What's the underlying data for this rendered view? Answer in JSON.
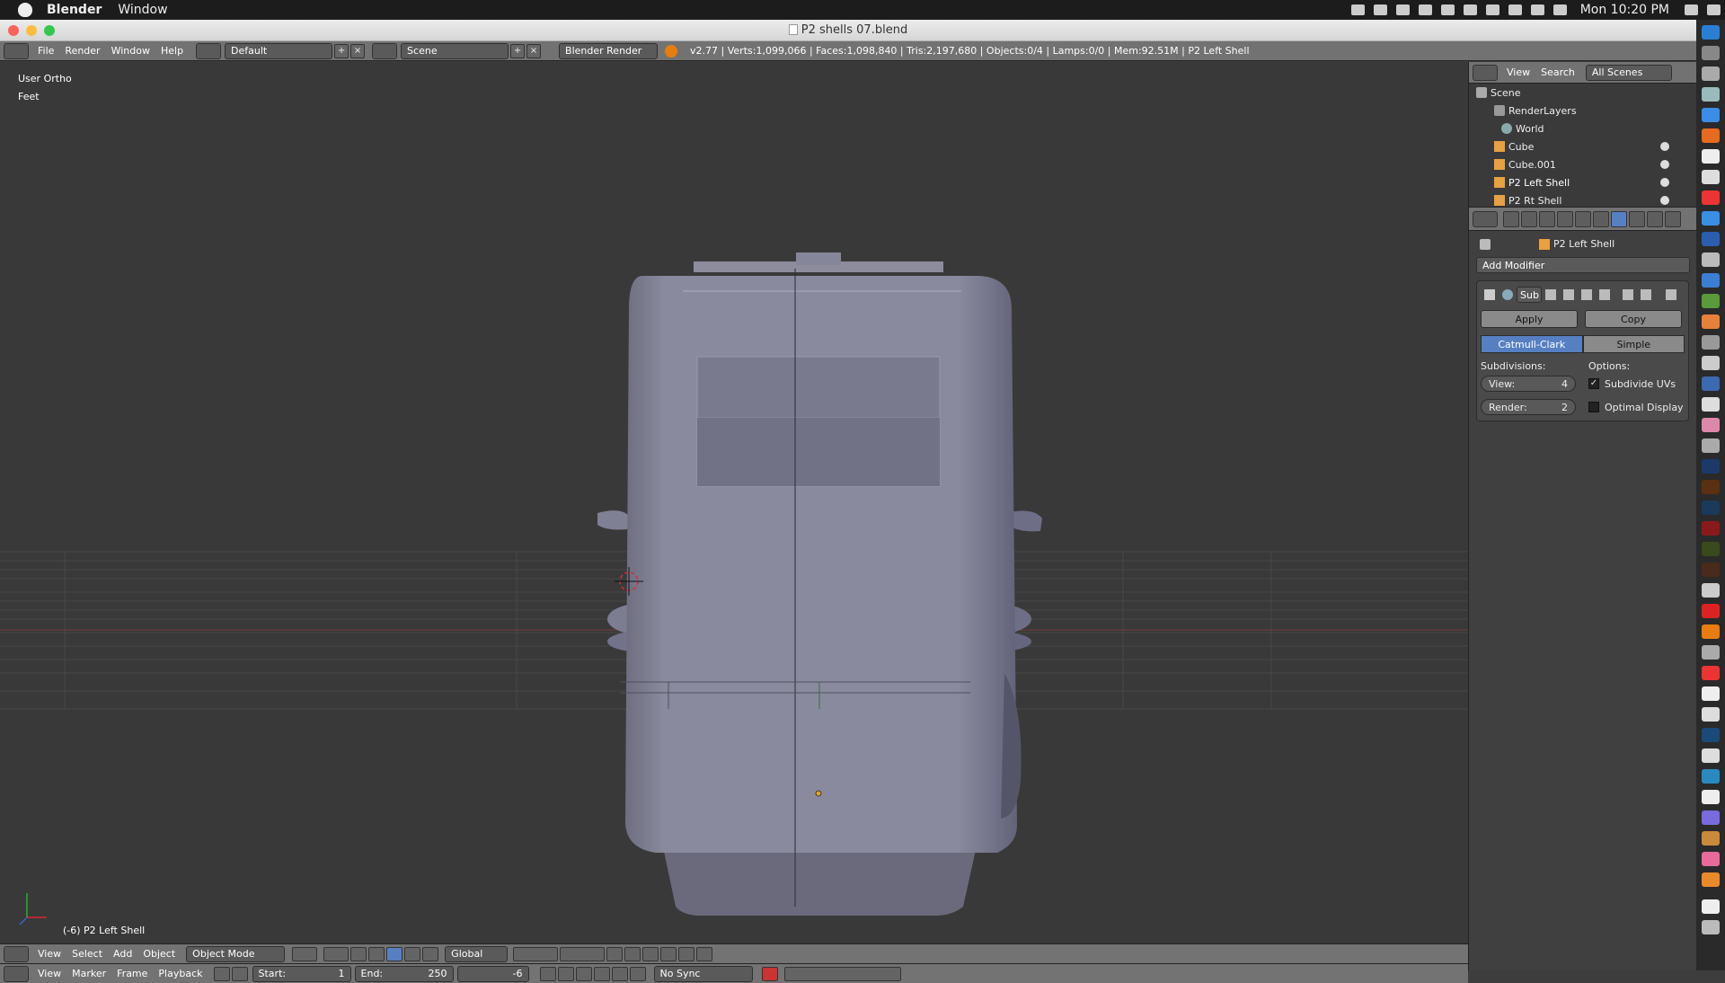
{
  "menubar": {
    "app": "Blender",
    "window": "Window",
    "clock": "Mon 10:20 PM"
  },
  "window": {
    "title": "P2 shells 07.blend"
  },
  "info": {
    "menus": [
      "File",
      "Render",
      "Window",
      "Help"
    ],
    "layout": "Default",
    "scene": "Scene",
    "engine": "Blender Render",
    "stats": "v2.77 | Verts:1,099,066 | Faces:1,098,840 | Tris:2,197,680 | Objects:0/4 | Lamps:0/0 | Mem:92.51M | P2 Left Shell"
  },
  "viewport": {
    "view": "User Ortho",
    "units": "Feet",
    "object": "(-6) P2 Left Shell"
  },
  "vp_header": {
    "menus": [
      "View",
      "Select",
      "Add",
      "Object"
    ],
    "mode": "Object Mode",
    "orientation": "Global"
  },
  "timeline": {
    "menus": [
      "View",
      "Marker",
      "Frame",
      "Playback"
    ],
    "start_label": "Start:",
    "start": "1",
    "end_label": "End:",
    "end": "250",
    "current": "-6",
    "sync": "No Sync"
  },
  "outliner": {
    "menus": [
      "View",
      "Search"
    ],
    "filter": "All Scenes",
    "items": [
      "Scene",
      "RenderLayers",
      "World",
      "Cube",
      "Cube.001",
      "P2 Left Shell",
      "P2 Rt Shell"
    ]
  },
  "properties": {
    "context": "P2 Left Shell",
    "add_modifier": "Add Modifier",
    "modifier_name": "Sub",
    "apply": "Apply",
    "copy": "Copy",
    "catmull": "Catmull-Clark",
    "simple": "Simple",
    "subdivisions_label": "Subdivisions:",
    "options_label": "Options:",
    "view_label": "View:",
    "view_value": "4",
    "render_label": "Render:",
    "render_value": "2",
    "subdivide_uvs": "Subdivide UVs",
    "optimal_display": "Optimal Display"
  },
  "colors": {
    "accent": "#5680c2",
    "header": "#727272",
    "viewport": "#393939"
  }
}
